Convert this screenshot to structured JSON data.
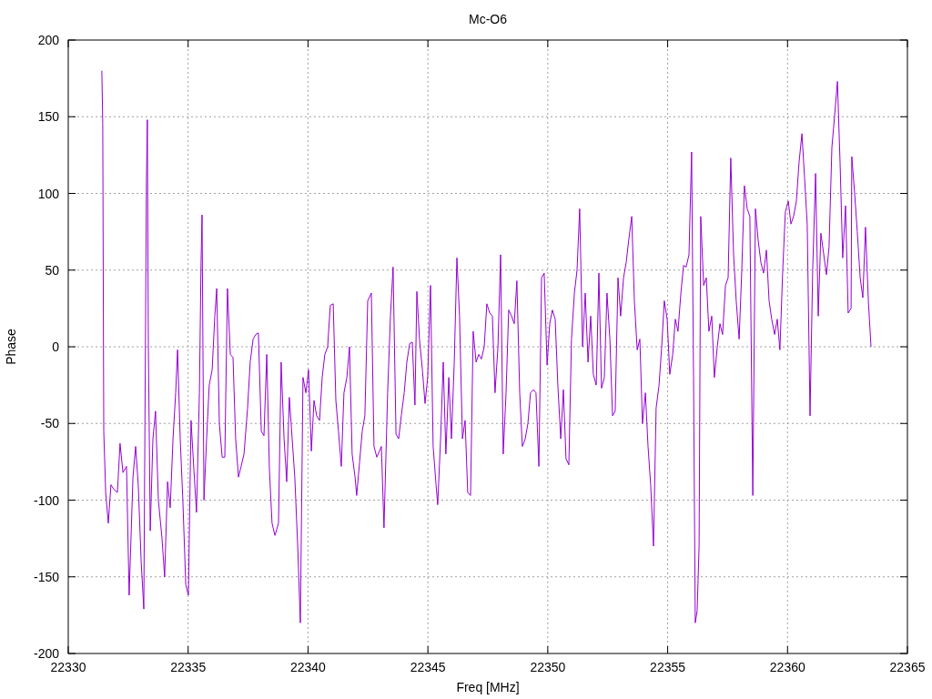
{
  "chart_data": {
    "type": "line",
    "title": "Mc-O6",
    "xlabel": "Freq [MHz]",
    "ylabel": "Phase",
    "xlim": [
      22330,
      22365
    ],
    "ylim": [
      -200,
      200
    ],
    "xticks": [
      22330,
      22335,
      22340,
      22345,
      22350,
      22355,
      22360,
      22365
    ],
    "yticks": [
      -200,
      -150,
      -100,
      -50,
      0,
      50,
      100,
      150,
      200
    ],
    "grid": true,
    "x": [
      22331.4,
      22331.44,
      22331.48,
      22331.56,
      22331.67,
      22331.78,
      22331.9,
      22332.05,
      22332.16,
      22332.28,
      22332.43,
      22332.54,
      22332.7,
      22332.81,
      22332.92,
      22333.04,
      22333.15,
      22333.26,
      22333.3,
      22333.34,
      22333.42,
      22333.53,
      22333.64,
      22333.76,
      22333.91,
      22334.02,
      22334.14,
      22334.25,
      22334.37,
      22334.48,
      22334.56,
      22334.67,
      22334.78,
      22334.9,
      22335.01,
      22335.12,
      22335.24,
      22335.35,
      22335.47,
      22335.54,
      22335.58,
      22335.66,
      22335.77,
      22335.88,
      22336.0,
      22336.11,
      22336.19,
      22336.3,
      22336.42,
      22336.53,
      22336.64,
      22336.76,
      22336.87,
      22336.98,
      22337.1,
      22337.21,
      22337.33,
      22337.48,
      22337.59,
      22337.71,
      22337.82,
      22337.93,
      22338.05,
      22338.16,
      22338.28,
      22338.39,
      22338.5,
      22338.62,
      22338.77,
      22338.88,
      22339.0,
      22339.11,
      22339.22,
      22339.34,
      22339.45,
      22339.57,
      22339.68,
      22339.79,
      22339.91,
      22340.02,
      22340.14,
      22340.25,
      22340.36,
      22340.48,
      22340.59,
      22340.7,
      22340.82,
      22340.93,
      22341.05,
      22341.16,
      22341.27,
      22341.39,
      22341.5,
      22341.62,
      22341.73,
      22341.84,
      22341.96,
      22342.03,
      22342.15,
      22342.26,
      22342.37,
      22342.49,
      22342.64,
      22342.75,
      22342.87,
      22342.98,
      22343.06,
      22343.17,
      22343.32,
      22343.44,
      22343.55,
      22343.67,
      22343.78,
      22343.89,
      22344.01,
      22344.12,
      22344.24,
      22344.35,
      22344.46,
      22344.54,
      22344.65,
      22344.77,
      22344.88,
      22344.99,
      22345.11,
      22345.22,
      22345.34,
      22345.41,
      22345.53,
      22345.64,
      22345.75,
      22345.87,
      22345.98,
      22346.1,
      22346.21,
      22346.32,
      22346.44,
      22346.55,
      22346.66,
      22346.78,
      22346.89,
      22347.01,
      22347.12,
      22347.23,
      22347.35,
      22347.46,
      22347.58,
      22347.69,
      22347.8,
      22347.92,
      22348.03,
      22348.14,
      22348.26,
      22348.37,
      22348.49,
      22348.6,
      22348.71,
      22348.83,
      22348.94,
      22349.06,
      22349.17,
      22349.28,
      22349.4,
      22349.51,
      22349.63,
      22349.74,
      22349.85,
      22349.97,
      22350.08,
      22350.19,
      22350.31,
      22350.42,
      22350.54,
      22350.65,
      22350.76,
      22350.88,
      22350.99,
      22351.11,
      22351.22,
      22351.33,
      22351.45,
      22351.56,
      22351.68,
      22351.79,
      22351.9,
      22352.02,
      22352.13,
      22352.24,
      22352.36,
      22352.47,
      22352.59,
      22352.7,
      22352.81,
      22352.93,
      22353.04,
      22353.16,
      22353.27,
      22353.38,
      22353.5,
      22353.61,
      22353.73,
      22353.84,
      22353.95,
      22354.07,
      22354.18,
      22354.29,
      22354.41,
      22354.52,
      22354.64,
      22354.75,
      22354.86,
      22354.98,
      22355.09,
      22355.21,
      22355.32,
      22355.43,
      22355.55,
      22355.66,
      22355.77,
      22355.89,
      22356.0,
      22356.08,
      22356.15,
      22356.23,
      22356.31,
      22356.38,
      22356.5,
      22356.61,
      22356.72,
      22356.84,
      22356.95,
      22357.07,
      22357.18,
      22357.29,
      22357.41,
      22357.52,
      22357.63,
      22357.75,
      22357.86,
      22357.98,
      22358.09,
      22358.2,
      22358.32,
      22358.43,
      22358.55,
      22358.66,
      22358.77,
      22358.89,
      22359.0,
      22359.12,
      22359.23,
      22359.34,
      22359.46,
      22359.57,
      22359.68,
      22359.8,
      22359.91,
      22360.03,
      22360.14,
      22360.25,
      22360.37,
      22360.48,
      22360.6,
      22360.71,
      22360.82,
      22360.94,
      22361.05,
      22361.17,
      22361.28,
      22361.39,
      22361.51,
      22361.62,
      22361.73,
      22361.85,
      22361.96,
      22362.08,
      22362.19,
      22362.3,
      22362.42,
      22362.53,
      22362.65,
      22362.68,
      22362.8,
      22362.91,
      22363.03,
      22363.14,
      22363.25,
      22363.37,
      22363.48
    ],
    "series": [
      {
        "color": "#9400d3",
        "values": [
          180,
          145,
          -55,
          -95,
          -115,
          -90,
          -93,
          -95,
          -63,
          -82,
          -78,
          -162,
          -85,
          -65,
          -90,
          -140,
          -171,
          108,
          148,
          0,
          -120,
          -60,
          -42,
          -100,
          -125,
          -150,
          -88,
          -105,
          -60,
          -30,
          -2,
          -60,
          -100,
          -155,
          -162,
          -48,
          -80,
          -108,
          -30,
          55,
          86,
          -100,
          -60,
          -25,
          -15,
          20,
          38,
          -50,
          -72,
          -72,
          38,
          -5,
          -7,
          -60,
          -85,
          -78,
          -70,
          -40,
          -10,
          5,
          8,
          9,
          -55,
          -58,
          -5,
          -80,
          -115,
          -123,
          -115,
          -10,
          -60,
          -88,
          -33,
          -60,
          -85,
          -130,
          -180,
          -20,
          -30,
          -15,
          -68,
          -35,
          -45,
          -48,
          -20,
          -5,
          0,
          27,
          28,
          -35,
          -55,
          -78,
          -30,
          -20,
          0,
          -70,
          -85,
          -97,
          -75,
          -55,
          -45,
          30,
          35,
          -65,
          -72,
          -68,
          -65,
          -118,
          -30,
          20,
          52,
          -57,
          -60,
          -45,
          -30,
          -10,
          2,
          3,
          -38,
          36,
          5,
          -15,
          -37,
          -20,
          40,
          -65,
          -90,
          -103,
          -60,
          -10,
          -70,
          -20,
          -60,
          -10,
          58,
          20,
          -60,
          -48,
          -95,
          -97,
          10,
          -10,
          -5,
          -8,
          0,
          28,
          22,
          20,
          -30,
          0,
          60,
          -70,
          -30,
          24,
          20,
          15,
          43,
          -30,
          -65,
          -60,
          -50,
          -30,
          -28,
          -30,
          -78,
          45,
          48,
          -12,
          15,
          24,
          18,
          -25,
          -60,
          -28,
          -73,
          -77,
          5,
          35,
          50,
          90,
          0,
          35,
          -10,
          20,
          -18,
          -25,
          48,
          -27,
          -20,
          35,
          5,
          -45,
          -42,
          45,
          20,
          45,
          55,
          70,
          85,
          30,
          -2,
          5,
          -50,
          -30,
          -65,
          -90,
          -130,
          -40,
          -25,
          0,
          30,
          18,
          -18,
          -5,
          18,
          10,
          35,
          53,
          52,
          60,
          127,
          -20,
          -180,
          -172,
          -130,
          85,
          40,
          45,
          10,
          20,
          -20,
          0,
          15,
          8,
          40,
          45,
          123,
          60,
          30,
          5,
          50,
          105,
          90,
          85,
          -97,
          90,
          70,
          55,
          48,
          63,
          30,
          18,
          8,
          18,
          -2,
          50,
          88,
          95,
          80,
          85,
          95,
          120,
          139,
          110,
          80,
          -45,
          50,
          113,
          20,
          74,
          60,
          47,
          65,
          130,
          150,
          173,
          120,
          58,
          92,
          22,
          25,
          124,
          100,
          75,
          45,
          32,
          78,
          30,
          0
        ]
      }
    ]
  }
}
